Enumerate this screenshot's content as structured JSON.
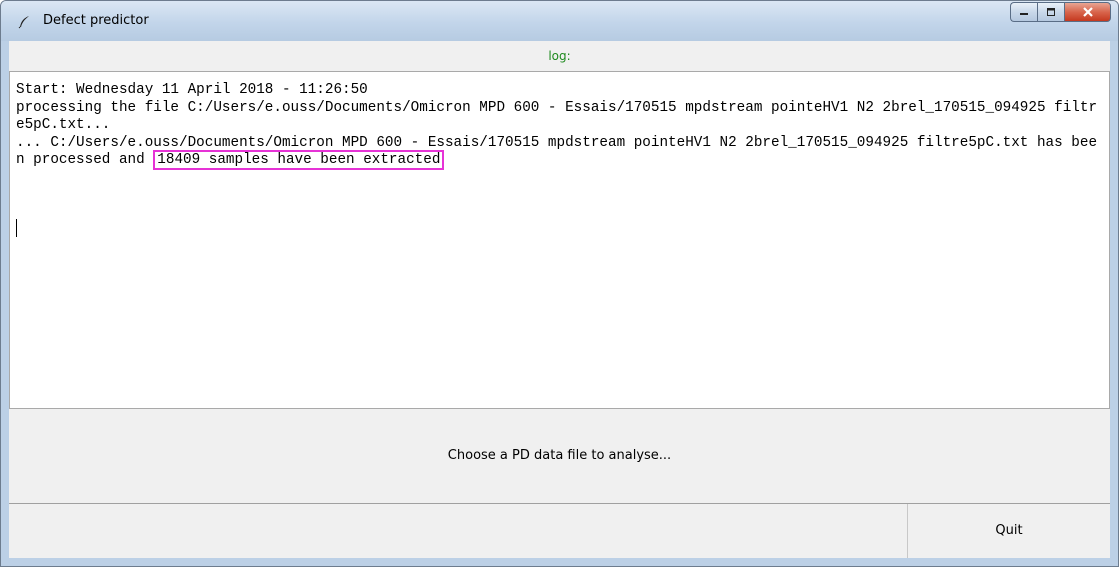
{
  "window": {
    "title": "Defect predictor",
    "icon": "feather-icon",
    "buttons": [
      "minimize-icon",
      "maximize-icon",
      "close-icon"
    ]
  },
  "log": {
    "label": "log:",
    "label_color": "#1e8a1e",
    "line1": "Start: Wednesday 11 April 2018 - 11:26:50",
    "line2": "processing the file C:/Users/e.ouss/Documents/Omicron MPD 600 - Essais/170515 mpdstream pointeHV1 N2 2brel_170515_094925 filtre5pC.txt...",
    "line3_prefix": "... C:/Users/e.ouss/Documents/Omicron MPD 600 - Essais/170515 mpdstream pointeHV1 N2 2brel_170515_094925 filtre5pC.txt has been processed and ",
    "line3_highlight": "18409 samples have been extracted",
    "highlight_color": "#e633d6"
  },
  "buttons": {
    "choose": "Choose a PD data file to analyse...",
    "quit": "Quit"
  }
}
